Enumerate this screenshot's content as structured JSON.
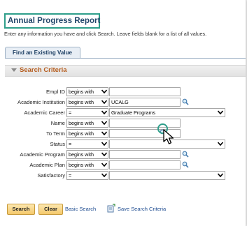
{
  "page": {
    "title": "Annual Progress Report",
    "instructions": "Enter any information you have and click Search. Leave fields blank for a list of all values."
  },
  "tabs": {
    "find_existing": "Find an Existing Value"
  },
  "criteria": {
    "title": "Search Criteria",
    "fields": [
      {
        "label": "Empl ID",
        "operator": "begins with",
        "value": "",
        "control": "text"
      },
      {
        "label": "Academic Institution",
        "operator": "begins with",
        "value": "UCALG",
        "control": "text-lookup"
      },
      {
        "label": "Academic Career",
        "operator": "=",
        "value": "Graduate Programs",
        "control": "select"
      },
      {
        "label": "Name",
        "operator": "begins with",
        "value": "",
        "control": "text"
      },
      {
        "label": "To Term",
        "operator": "begins with",
        "value": "",
        "control": "text-lookup"
      },
      {
        "label": "Status",
        "operator": "=",
        "value": "",
        "control": "select"
      },
      {
        "label": "Academic Program",
        "operator": "begins with",
        "value": "",
        "control": "text-lookup"
      },
      {
        "label": "Academic Plan",
        "operator": "begins with",
        "value": "",
        "control": "text-lookup"
      },
      {
        "label": "Satisfactory",
        "operator": "=",
        "value": "",
        "control": "select"
      }
    ]
  },
  "actions": {
    "search": "Search",
    "clear": "Clear",
    "basic_search": "Basic Search",
    "save_criteria": "Save Search Criteria"
  },
  "icons": {
    "lookup": "magnifier-icon",
    "dropdown": "chevron-down-icon",
    "save": "save-criteria-icon",
    "cursor": "mouse-pointer-icon"
  },
  "colors": {
    "title_highlight": "#2e9e8a",
    "title_text": "#22466a",
    "criteria_title": "#b55d1f",
    "button_fill": "#f4c96c",
    "link": "#1c4a8f"
  }
}
